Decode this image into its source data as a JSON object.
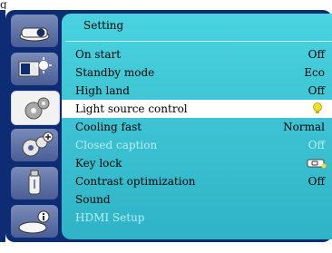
{
  "header_fragment": "g",
  "menu": {
    "title": "Setting",
    "sidebar": [
      {
        "name": "image-menu"
      },
      {
        "name": "display-menu"
      },
      {
        "name": "setting-menu",
        "active": true
      },
      {
        "name": "expand-menu"
      },
      {
        "name": "usb-menu"
      },
      {
        "name": "info-menu"
      }
    ],
    "rows": [
      {
        "label": "On start",
        "value": "Off"
      },
      {
        "label": "Standby mode",
        "value": "Eco"
      },
      {
        "label": "High land",
        "value": "Off"
      },
      {
        "label": "Light source control",
        "value_icon": "bulb-icon",
        "selected": true
      },
      {
        "label": "Cooling fast",
        "value": "Normal"
      },
      {
        "label": "Closed caption",
        "value": "Off",
        "disabled": true
      },
      {
        "label": "Key lock",
        "value_icon": "key-lock-icon"
      },
      {
        "label": "Contrast optimization",
        "value": "Off"
      },
      {
        "label": "Sound",
        "value": ""
      },
      {
        "label": "HDMI Setup",
        "value": "",
        "disabled": true
      }
    ]
  },
  "colors": {
    "frame": "#0d2c74",
    "panel": "#3cc6d6",
    "selected_row": "#ffffff",
    "disabled_text": "#b8eef3",
    "bulb": "#f2df2a"
  }
}
